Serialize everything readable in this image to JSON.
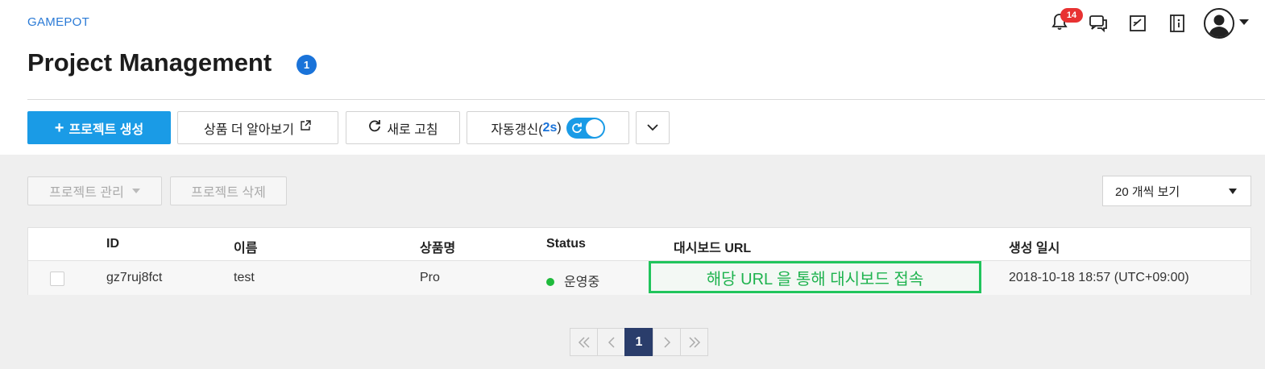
{
  "header": {
    "brand": "GAMEPOT",
    "title": "Project Management",
    "title_badge": "1",
    "notification_count": "14",
    "icons": [
      "bell-icon",
      "chat-icon",
      "edit-note-icon",
      "info-book-icon",
      "user-avatar-icon"
    ]
  },
  "toolbar": {
    "create_label": "프로젝트 생성",
    "learn_more_label": "상품 더 알아보기",
    "refresh_label": "새로 고침",
    "auto_refresh_label": "자동갱신(",
    "auto_refresh_interval": "2s",
    "auto_refresh_close": ")",
    "auto_refresh_on": true
  },
  "actions": {
    "manage_label": "프로젝트 관리",
    "delete_label": "프로젝트 삭제",
    "page_size_label": "20 개씩 보기"
  },
  "table": {
    "columns": [
      "ID",
      "이름",
      "상품명",
      "Status",
      "대시보드 URL",
      "생성 일시"
    ],
    "rows": [
      {
        "id": "gz7ruj8fct",
        "name": "test",
        "product": "Pro",
        "status": "운영중",
        "dashboard_url": "해당 URL 을 통해 대시보드 접속",
        "created_at": "2018-10-18 18:57 (UTC+09:00)"
      }
    ]
  },
  "pagination": {
    "current_page": "1"
  },
  "colors": {
    "primary": "#1a9be6",
    "brand_link": "#2a7ad6",
    "status_active": "#1fba3c",
    "highlight_green": "#21c45c",
    "pager_active": "#2a3d6b",
    "notification": "#e83232"
  }
}
